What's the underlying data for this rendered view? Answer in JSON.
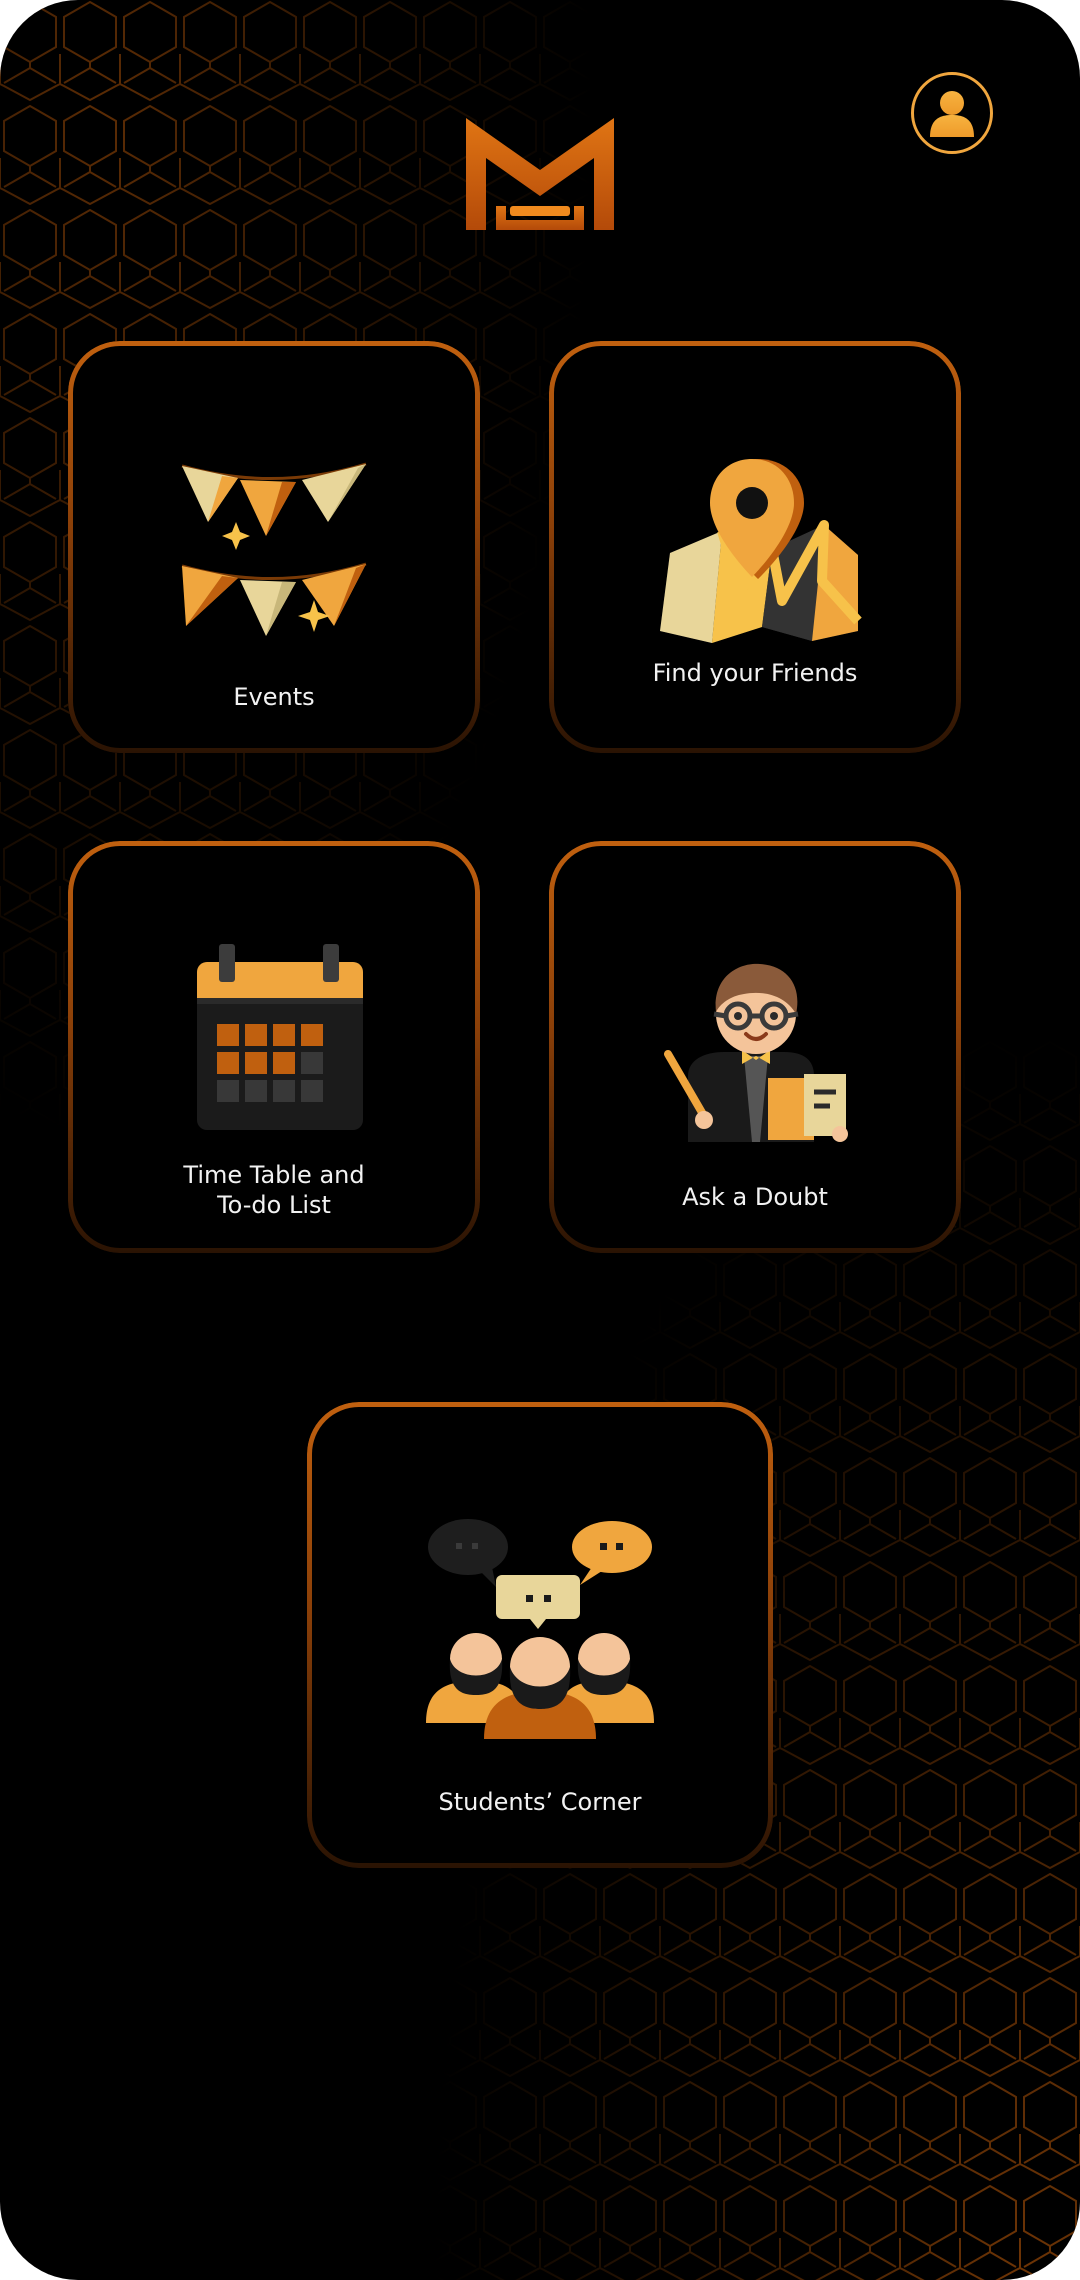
{
  "app": {
    "logo_letter": "M",
    "accent_color": "#f0a63e",
    "brand_color": "#c0600f"
  },
  "header": {
    "profile_icon": "user-avatar-icon"
  },
  "tiles": [
    {
      "id": "events",
      "label": "Events",
      "icon": "bunting-flags-icon"
    },
    {
      "id": "friends",
      "label": "Find your Friends",
      "icon": "map-pin-icon"
    },
    {
      "id": "timetable",
      "label": "Time Table and\nTo-do List",
      "icon": "calendar-icon"
    },
    {
      "id": "doubt",
      "label": "Ask a Doubt",
      "icon": "teacher-icon"
    },
    {
      "id": "corner",
      "label": "Students’ Corner",
      "icon": "group-chat-icon"
    }
  ]
}
